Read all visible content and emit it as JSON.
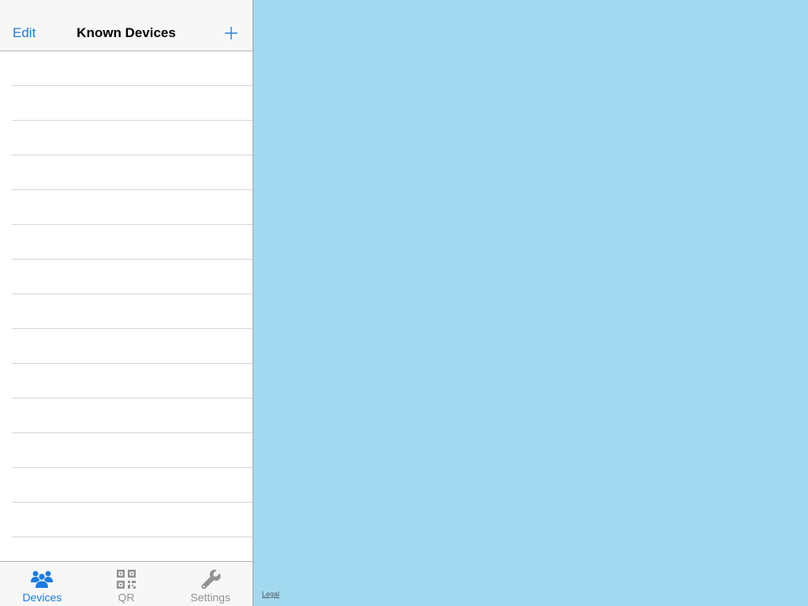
{
  "navbar": {
    "edit_label": "Edit",
    "title": "Known Devices",
    "add_icon": "plus-icon"
  },
  "device_list": {
    "rows": [
      "",
      "",
      "",
      "",
      "",
      "",
      "",
      "",
      "",
      "",
      "",
      "",
      "",
      "",
      ""
    ]
  },
  "tabbar": {
    "tabs": [
      {
        "label": "Devices",
        "icon": "people-icon",
        "active": true
      },
      {
        "label": "QR",
        "icon": "qr-code-icon",
        "active": false
      },
      {
        "label": "Settings",
        "icon": "wrench-icon",
        "active": false
      }
    ]
  },
  "map": {
    "legal_label": "Legal",
    "water_color": "#a3d9f0"
  },
  "colors": {
    "accent": "#1a7ce1",
    "inactive": "#929292"
  }
}
